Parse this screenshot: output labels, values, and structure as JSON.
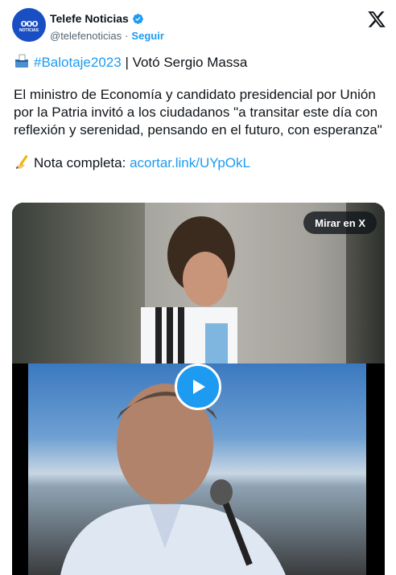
{
  "account": {
    "name": "Telefe Noticias",
    "handle": "@telefenoticias",
    "separator": "·",
    "follow_label": "Seguir",
    "avatar_logo": "ooo",
    "avatar_sub": "NOTICIAS",
    "verified_icon": "verified-badge-icon",
    "verified_color": "#1d9bf0"
  },
  "platform_icon": "x-logo-icon",
  "tweet": {
    "line1_hashtag": "#Balotaje2023",
    "line1_rest": " | Votó Sergio Massa",
    "line1_emoji": "ballot-box-icon",
    "body": "El ministro de Economía y candidato presidencial por Unión por la Patria invitó a los ciudadanos \"a transitar este día con reflexión y serenidad, pensando en el futuro, con esperanza\"",
    "note_emoji": "writing-hand-icon",
    "note_label": "Nota completa: ",
    "note_link": "acortar.link/UYpOkL"
  },
  "media": {
    "watch_on_x_label": "Mirar en X",
    "play_icon": "play-icon"
  },
  "colors": {
    "link": "#1d9bf0",
    "text": "#0f1419",
    "secondary": "#536471",
    "brand_avatar": "#1a4fc4"
  }
}
